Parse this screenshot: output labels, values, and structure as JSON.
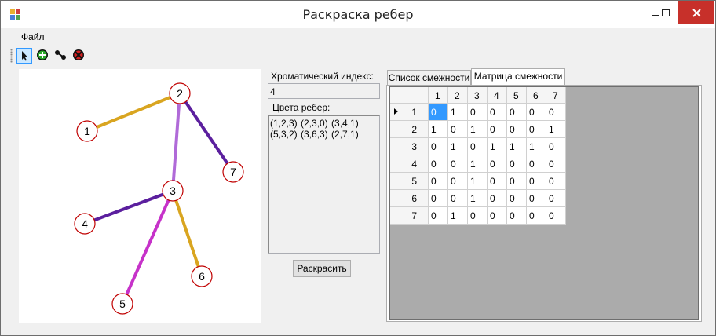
{
  "window": {
    "title": "Раскраска ребер"
  },
  "menu": {
    "items": [
      "Файл"
    ]
  },
  "toolbar": {
    "tools": [
      "pointer-icon",
      "add-vertex-icon",
      "add-edge-icon",
      "delete-icon"
    ]
  },
  "colors": {
    "c0": "#d9a520",
    "c1": "#a64fcf",
    "c2": "#5b1f9e",
    "c3": "#c632c9"
  },
  "graph": {
    "vertices": [
      {
        "id": 1,
        "label": "1"
      },
      {
        "id": 2,
        "label": "2"
      },
      {
        "id": 3,
        "label": "3"
      },
      {
        "id": 4,
        "label": "4"
      },
      {
        "id": 5,
        "label": "5"
      },
      {
        "id": 6,
        "label": "6"
      },
      {
        "id": 7,
        "label": "7"
      }
    ],
    "edges": [
      {
        "a": 1,
        "b": 2,
        "color": 3
      },
      {
        "a": 2,
        "b": 3,
        "color": 0
      },
      {
        "a": 3,
        "b": 4,
        "color": 1
      },
      {
        "a": 5,
        "b": 3,
        "color": 2
      },
      {
        "a": 3,
        "b": 6,
        "color": 3
      },
      {
        "a": 2,
        "b": 7,
        "color": 1
      }
    ]
  },
  "chromatic": {
    "label": "Хроматический индекс:",
    "value": "4"
  },
  "edge_colors": {
    "label": "Цвета ребер:",
    "text": "(1,2,3) (2,3,0) (3,4,1) (5,3,2) (3,6,3) (2,7,1)"
  },
  "color_button": "Раскрасить",
  "tabs": [
    {
      "label": "Список смежности",
      "selected": false
    },
    {
      "label": "Матрица смежности",
      "selected": true
    }
  ],
  "matrix": {
    "headers": [
      "1",
      "2",
      "3",
      "4",
      "5",
      "6",
      "7"
    ],
    "rows": [
      [
        "0",
        "1",
        "0",
        "0",
        "0",
        "0",
        "0"
      ],
      [
        "1",
        "0",
        "1",
        "0",
        "0",
        "0",
        "1"
      ],
      [
        "0",
        "1",
        "0",
        "1",
        "1",
        "1",
        "0"
      ],
      [
        "0",
        "0",
        "1",
        "0",
        "0",
        "0",
        "0"
      ],
      [
        "0",
        "0",
        "1",
        "0",
        "0",
        "0",
        "0"
      ],
      [
        "0",
        "0",
        "1",
        "0",
        "0",
        "0",
        "0"
      ],
      [
        "0",
        "1",
        "0",
        "0",
        "0",
        "0",
        "0"
      ]
    ],
    "selected_row": 0,
    "selected_col": 0
  }
}
